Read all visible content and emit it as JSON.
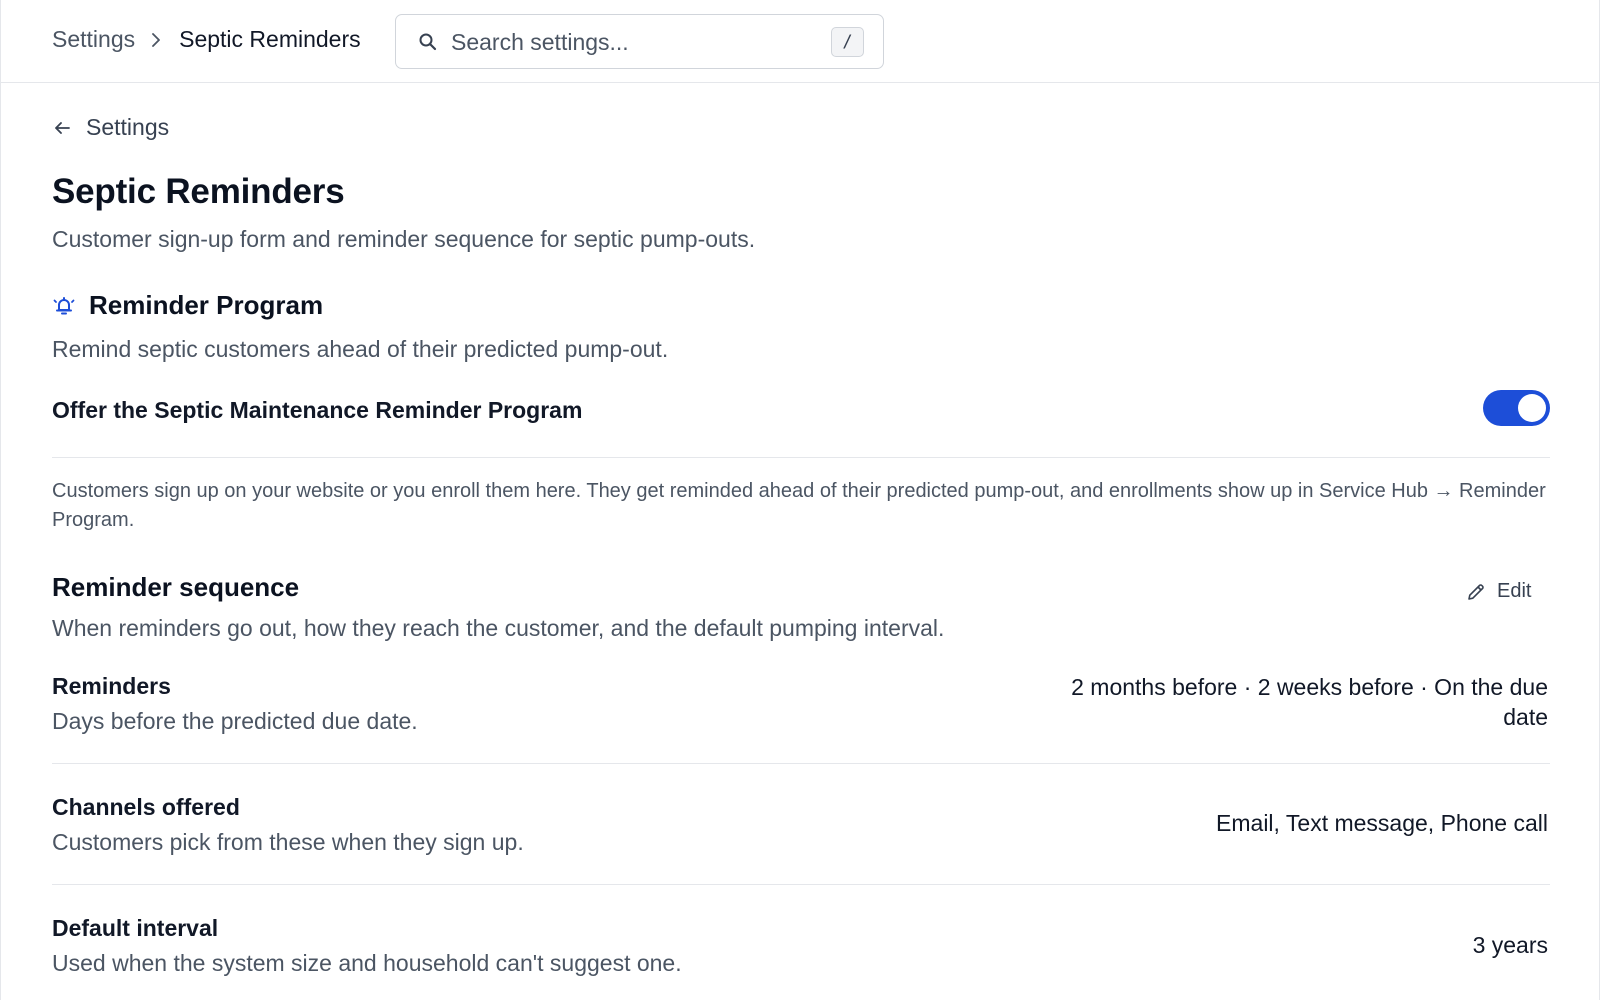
{
  "breadcrumb": {
    "root": "Settings",
    "current": "Septic Reminders"
  },
  "search": {
    "placeholder": "Search settings...",
    "shortcut": "/"
  },
  "back_link": "Settings",
  "page": {
    "title": "Septic Reminders",
    "subtitle": "Customer sign-up form and reminder sequence for septic pump-outs."
  },
  "program": {
    "title": "Reminder Program",
    "description": "Remind septic customers ahead of their predicted pump-out.",
    "toggle_label": "Offer the Septic Maintenance Reminder Program",
    "toggle_on": true,
    "info": "Customers sign up on your website or you enroll them here. They get reminded ahead of their predicted pump-out, and enrollments show up in Service Hub → Reminder Program."
  },
  "sequence": {
    "title": "Reminder sequence",
    "description": "When reminders go out, how they reach the customer, and the default pumping interval.",
    "edit_label": "Edit",
    "rows": [
      {
        "label": "Reminders",
        "help": "Days before the predicted due date.",
        "value": "2 months before · 2 weeks before · On the due date"
      },
      {
        "label": "Channels offered",
        "help": "Customers pick from these when they sign up.",
        "value": "Email, Text message, Phone call"
      },
      {
        "label": "Default interval",
        "help": "Used when the system size and household can't suggest one.",
        "value": "3 years"
      }
    ]
  },
  "colors": {
    "accent": "#1d4ed8",
    "text_primary": "#111827",
    "text_secondary": "#4b5563",
    "divider": "#e5e7eb"
  },
  "icons": {
    "search": "search-icon",
    "breadcrumb_separator": "chevron-right-icon",
    "back": "arrow-left-icon",
    "section": "bell-ring-icon",
    "edit": "pencil-icon"
  }
}
